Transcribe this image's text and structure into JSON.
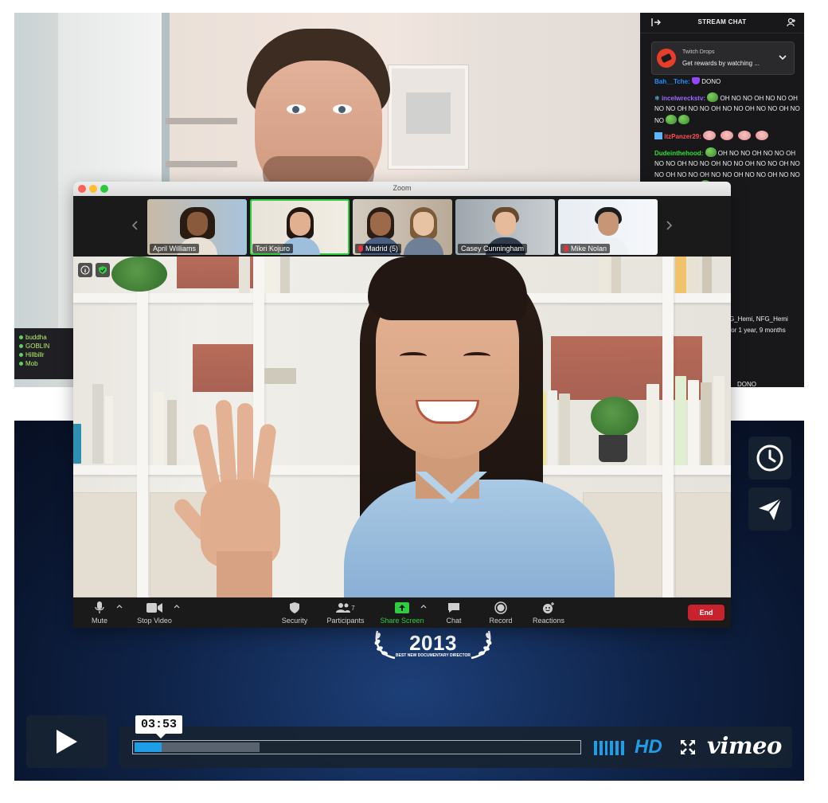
{
  "vimeo": {
    "laurel_year": "2013",
    "laurel_text": "BEST NEW DOCUMENTARY DIRECTOR",
    "timecode": "03:53",
    "played_fraction": 0.06,
    "loaded_fraction": 0.28,
    "hd_label": "HD",
    "logo_text": "vimeo",
    "colors": {
      "accent": "#1f9ee8",
      "panel": "#172332"
    }
  },
  "bg_video": {
    "mini_chat": [
      "buddha",
      "GOBLIN",
      "Hillbillr",
      "Mob"
    ]
  },
  "twitch": {
    "title": "STREAM CHAT",
    "drops_title": "Twitch Drops",
    "drops_text": "Get rewards by watching ...",
    "messages": [
      {
        "user": "Bah__Tche:",
        "color": "#1e90ff",
        "text": "DONO"
      },
      {
        "user": "incelwreckstv:",
        "color": "#9b6bff",
        "text": "OH NO NO OH NO NO OH NO NO OH NO NO OH NO NO OH NO NO OH NO NO"
      },
      {
        "user": "itzPanzer29:",
        "color": "#ff4f4f",
        "text": ""
      },
      {
        "user": "Dudeinthehood:",
        "color": "#2ee02e",
        "text": "OH NO NO OH NO NO OH NO NO OH NO NO OH NO NO OH NO NO OH NO NO OH NO NO OH NO NO OH NO NO OH NO NO OH NO NO OH"
      }
    ],
    "tail_lines": [
      "G_Hemi, NFG_Hemi",
      "for 1 year, 9 months",
      "DONO"
    ]
  },
  "zoom": {
    "window_title": "Zoom",
    "participants": [
      {
        "name": "April Williams",
        "active": false,
        "muted": false
      },
      {
        "name": "Tori Kojuro",
        "active": true,
        "muted": false
      },
      {
        "name": "Madrid (5)",
        "active": false,
        "muted": true
      },
      {
        "name": "Casey Cunningham",
        "active": false,
        "muted": false
      },
      {
        "name": "Mike Nolan",
        "active": false,
        "muted": true
      }
    ],
    "toolbar": {
      "mute": "Mute",
      "stop_video": "Stop Video",
      "security": "Security",
      "participants": "Participants",
      "participants_count": "7",
      "share_screen": "Share Screen",
      "chat": "Chat",
      "record": "Record",
      "reactions": "Reactions",
      "end": "End"
    }
  }
}
